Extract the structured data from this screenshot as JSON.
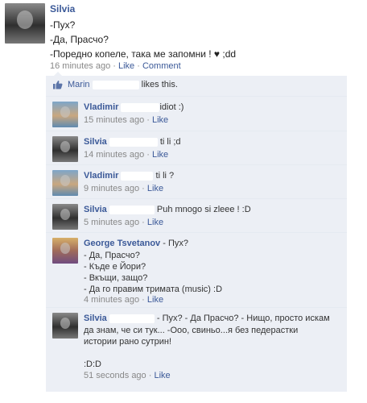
{
  "post": {
    "author": "Silvia",
    "lines": [
      "-Пух?",
      "-Да, Прасчо?",
      "-Поредно копеле, така ме запомни ! ♥ ;dd"
    ],
    "time": "16 minutes ago",
    "like": "Like",
    "comment": "Comment"
  },
  "likes": {
    "who": "Marin",
    "text": "likes this."
  },
  "comments": [
    {
      "author": "Vladimir",
      "text": "idiot :)",
      "time": "15 minutes ago",
      "like": "Like"
    },
    {
      "author": "Silvia",
      "text": "ti li ;d",
      "time": "14 minutes ago",
      "like": "Like"
    },
    {
      "author": "Vladimir",
      "text": "ti li ?",
      "time": "9 minutes ago",
      "like": "Like"
    },
    {
      "author": "Silvia",
      "text": "Puh mnogo si zleee ! :D",
      "time": "5 minutes ago",
      "like": "Like"
    },
    {
      "author": "George Tsvetanov",
      "text": "- Пух?",
      "lines": [
        "- Да, Прасчо?",
        "- Къде е Йори?",
        "- Вкъщи, защо?",
        "- Да го правим тримата (music) :D"
      ],
      "time": "4 minutes ago",
      "like": "Like"
    },
    {
      "author": "Silvia",
      "text": "- Пух? - Да Прасчо? - Нищо, просто искам",
      "lines": [
        "да знам, че си тук... -Ооо, свиньо...я без педерастки",
        "истории рано сутрин!",
        "",
        ":D:D"
      ],
      "time": "51 seconds ago",
      "like": "Like"
    }
  ]
}
